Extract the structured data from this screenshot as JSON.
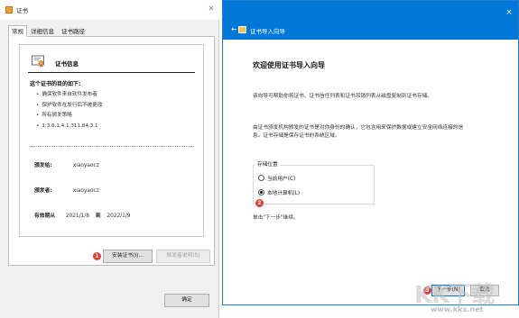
{
  "left_window": {
    "title": "证书",
    "tabs": [
      {
        "label": "常规"
      },
      {
        "label": "详细信息"
      },
      {
        "label": "证书路径"
      }
    ],
    "cert_info_title": "证书信息",
    "purpose_heading": "这个证书的目的如下:",
    "purposes": [
      "确保软件来自软件发布者",
      "保护软件在发行后不被更改",
      "所有颁发策略",
      "1.3.6.1.4.1.311.84.3.1"
    ],
    "issued_to_label": "颁发给:",
    "issued_to_value": "xiaoyaocz",
    "issued_by_label": "颁发者:",
    "issued_by_value": "xiaoyaocz",
    "validity_label": "有效期从",
    "validity_from": "2021/1/8",
    "validity_to_word": "到",
    "validity_to": "2022/1/9",
    "install_button": "安装证书(I)...",
    "issuer_statement_button": "颁发者说明(S)",
    "ok_button": "确定",
    "badge_1": "1"
  },
  "right_window": {
    "back_glyph": "←",
    "title": "证书导入向导",
    "close_glyph": "×",
    "heading": "欢迎使用证书导入向导",
    "intro": "该向导可帮助你将证书、证书信任列表和证书吊销列表从磁盘复制到证书存储。",
    "explanation": [
      "由证书颁发机构颁发的证书是对你身份的确认，它包含用来保护数据或建立安全网络连接的信",
      "息。证书存储是保存证书的系统区域。"
    ],
    "storage_label": "存储位置",
    "options": [
      {
        "label": "当前用户(C)",
        "checked": false
      },
      {
        "label": "本地计算机(L)",
        "checked": true
      }
    ],
    "badge_2": "2",
    "continue_hint": "单击\"下一步\"继续。",
    "next_button": "下一步(N)",
    "cancel_button": "取消",
    "badge_3": "3"
  },
  "watermark": {
    "logo_text": "KK下载",
    "url": "www.kkx.net"
  },
  "colors": {
    "accent": "#0078d7",
    "badge": "#e63b3b",
    "cert_icon": "#e8a33a"
  }
}
